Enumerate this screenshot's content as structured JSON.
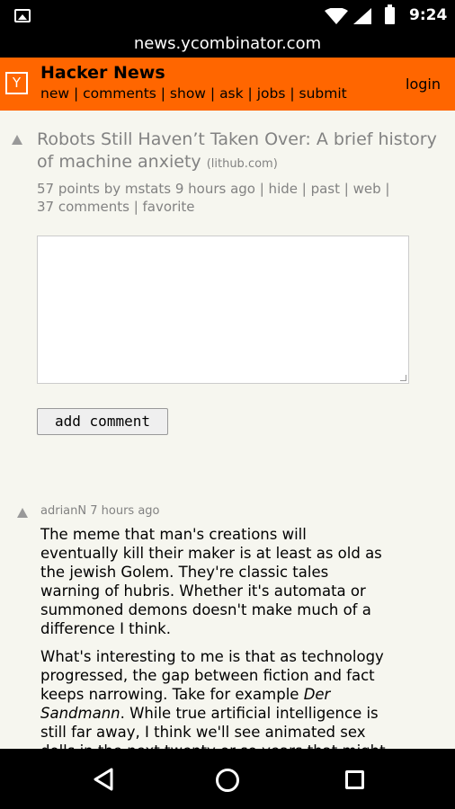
{
  "status_bar": {
    "time": "9:24"
  },
  "browser": {
    "url": "news.ycombinator.com"
  },
  "header": {
    "logo_letter": "Y",
    "title": "Hacker News",
    "nav": [
      "new",
      "comments",
      "show",
      "ask",
      "jobs",
      "submit"
    ],
    "login": "login"
  },
  "story": {
    "title": "Robots Still Haven’t Taken Over: A brief history of machine anxiety",
    "site": "(lithub.com)",
    "subtext_line1": "57 points by mstats 9 hours ago | hide | past | web |",
    "subtext_line2": "37 comments | favorite"
  },
  "reply": {
    "button_label": "add comment"
  },
  "comment": {
    "meta": "adrianN 7 hours ago",
    "paragraph1": "The meme that man's creations will eventually kill their maker is at least as old as the jewish Golem. They're classic tales warning of hubris. Whether it's automata or summoned demons doesn't make much of a difference I think.",
    "paragraph2_before": "What's interesting to me is that as technology progressed, the gap between fiction and fact keeps narrowing. Take for example ",
    "paragraph2_italic": "Der Sandmann",
    "paragraph2_after": ". While true artificial intelligence is still far away, I think we'll see animated sex dolls in the next twenty or so years that might"
  }
}
